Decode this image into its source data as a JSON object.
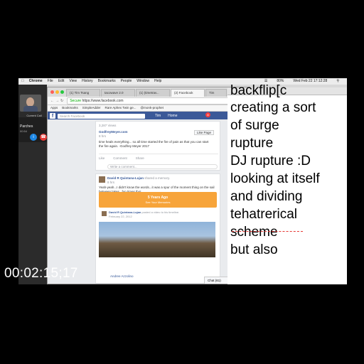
{
  "menubar": {
    "app_name": "Chrome",
    "items": [
      "File",
      "Edit",
      "View",
      "History",
      "Bookmarks",
      "People",
      "Window",
      "Help"
    ],
    "datetime": "Wed Feb 22  17:12:28",
    "battery": "80%"
  },
  "call": {
    "label": "Current Call",
    "caller_name": "Parches",
    "duration": "00:54"
  },
  "browser": {
    "tabs": [
      "(1) Tim Tsang",
      "tacowave 2.0",
      "(1) (timetrav...",
      "(2) Facebook",
      "Tim"
    ],
    "url_secure": "Secure",
    "url": "https://www.facebook.com",
    "bookmarks": [
      "Apps",
      "Bookmarks",
      "SimpleAdder",
      "Rare Aphex Twin ge...",
      "@monk-prophet"
    ]
  },
  "facebook": {
    "search_placeholder": "Search Facebook",
    "user_name": "Tim",
    "home_label": "Home",
    "badge_count": "8",
    "post1": {
      "views": "3,287 Views",
      "page_name": "GodfreyMeyer.com",
      "time": "8 hrs",
      "like_page": "Like Page",
      "text": "time heals everything... so all time started the fire of pain as that you can start the fire again. -Godfrey Meyer 2017",
      "actions": [
        "Like",
        "Comment",
        "Share"
      ]
    },
    "composer_placeholder": "Write a comment...",
    "post2": {
      "author": "David R Quintana-Lujan",
      "action": "shared a memory.",
      "time": "8 hrs",
      "text": "Yeah-yeah...I didn't know the words...it was a spur of the moment thing on the sail between lakes...fun times tho!",
      "memory_title": "5 Years Ago",
      "memory_sub": "See Your Memories",
      "inner_author": "David R Quintana-Lujan",
      "inner_action": "posted a video to his timeline.",
      "inner_time": "February 22, 2012"
    },
    "bottom_tag": "Andree Azzolino",
    "chat_label": "Chat (61)"
  },
  "document": {
    "lines": [
      "backflip[c",
      "creating a sort",
      "of surge",
      "rupture",
      "DJ rupture :D",
      "looking at itself",
      "and dividing",
      "tehatrerical",
      "scheme",
      "but also"
    ]
  },
  "timecode": "00:02:15;17"
}
